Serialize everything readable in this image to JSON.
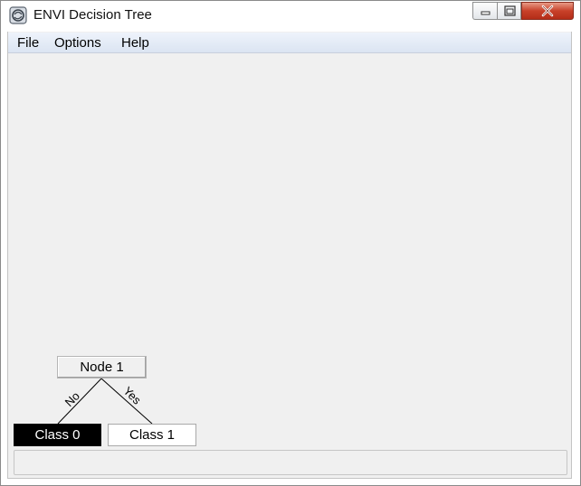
{
  "window": {
    "title": "ENVI Decision Tree",
    "controls": [
      "minimize",
      "maximize",
      "close"
    ]
  },
  "menubar": {
    "items": [
      {
        "label": "File"
      },
      {
        "label": "Options"
      },
      {
        "label": "Help"
      }
    ]
  },
  "tree": {
    "root": {
      "label": "Node 1"
    },
    "branch_no": {
      "label": "No"
    },
    "branch_yes": {
      "label": "Yes"
    },
    "leaf_no": {
      "label": "Class 0",
      "color": "#000000"
    },
    "leaf_yes": {
      "label": "Class 1",
      "color": "#ffffff"
    }
  },
  "status": {
    "text": ""
  }
}
